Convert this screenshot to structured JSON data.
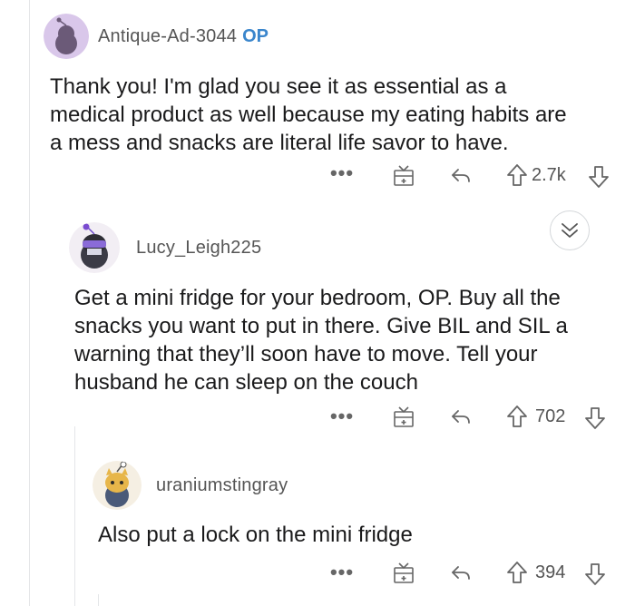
{
  "comments": [
    {
      "username": "Antique-Ad-3044",
      "badge": "OP",
      "body_lines": [
        "Thank you! I'm glad you see it as essential as a",
        "medical product as well because my eating habits are",
        "a mess and snacks are literal life savor to have."
      ],
      "score": "2.7k"
    },
    {
      "username": "Lucy_Leigh225",
      "body_lines": [
        "Get a mini fridge for your bedroom, OP. Buy all the",
        "snacks you want to put in there. Give BIL and SIL a",
        "warning that they’ll soon have to move. Tell your",
        "husband he can sleep on the couch"
      ],
      "score": "702"
    },
    {
      "username": "uraniumstingray",
      "body_lines": [
        "Also put a lock on the mini fridge"
      ],
      "score": "394"
    }
  ],
  "more_label": "•••",
  "icons": {
    "more": "more-options-icon",
    "award": "gift-award-icon",
    "reply": "reply-arrow-icon",
    "upvote": "upvote-arrow-icon",
    "downvote": "downvote-arrow-icon",
    "collapse": "chevron-double-down-icon"
  },
  "colors": {
    "op_badge": "#3b86cc",
    "text": "#1a1a1b",
    "meta": "#555555",
    "thread_line": "#e4e6e8"
  }
}
